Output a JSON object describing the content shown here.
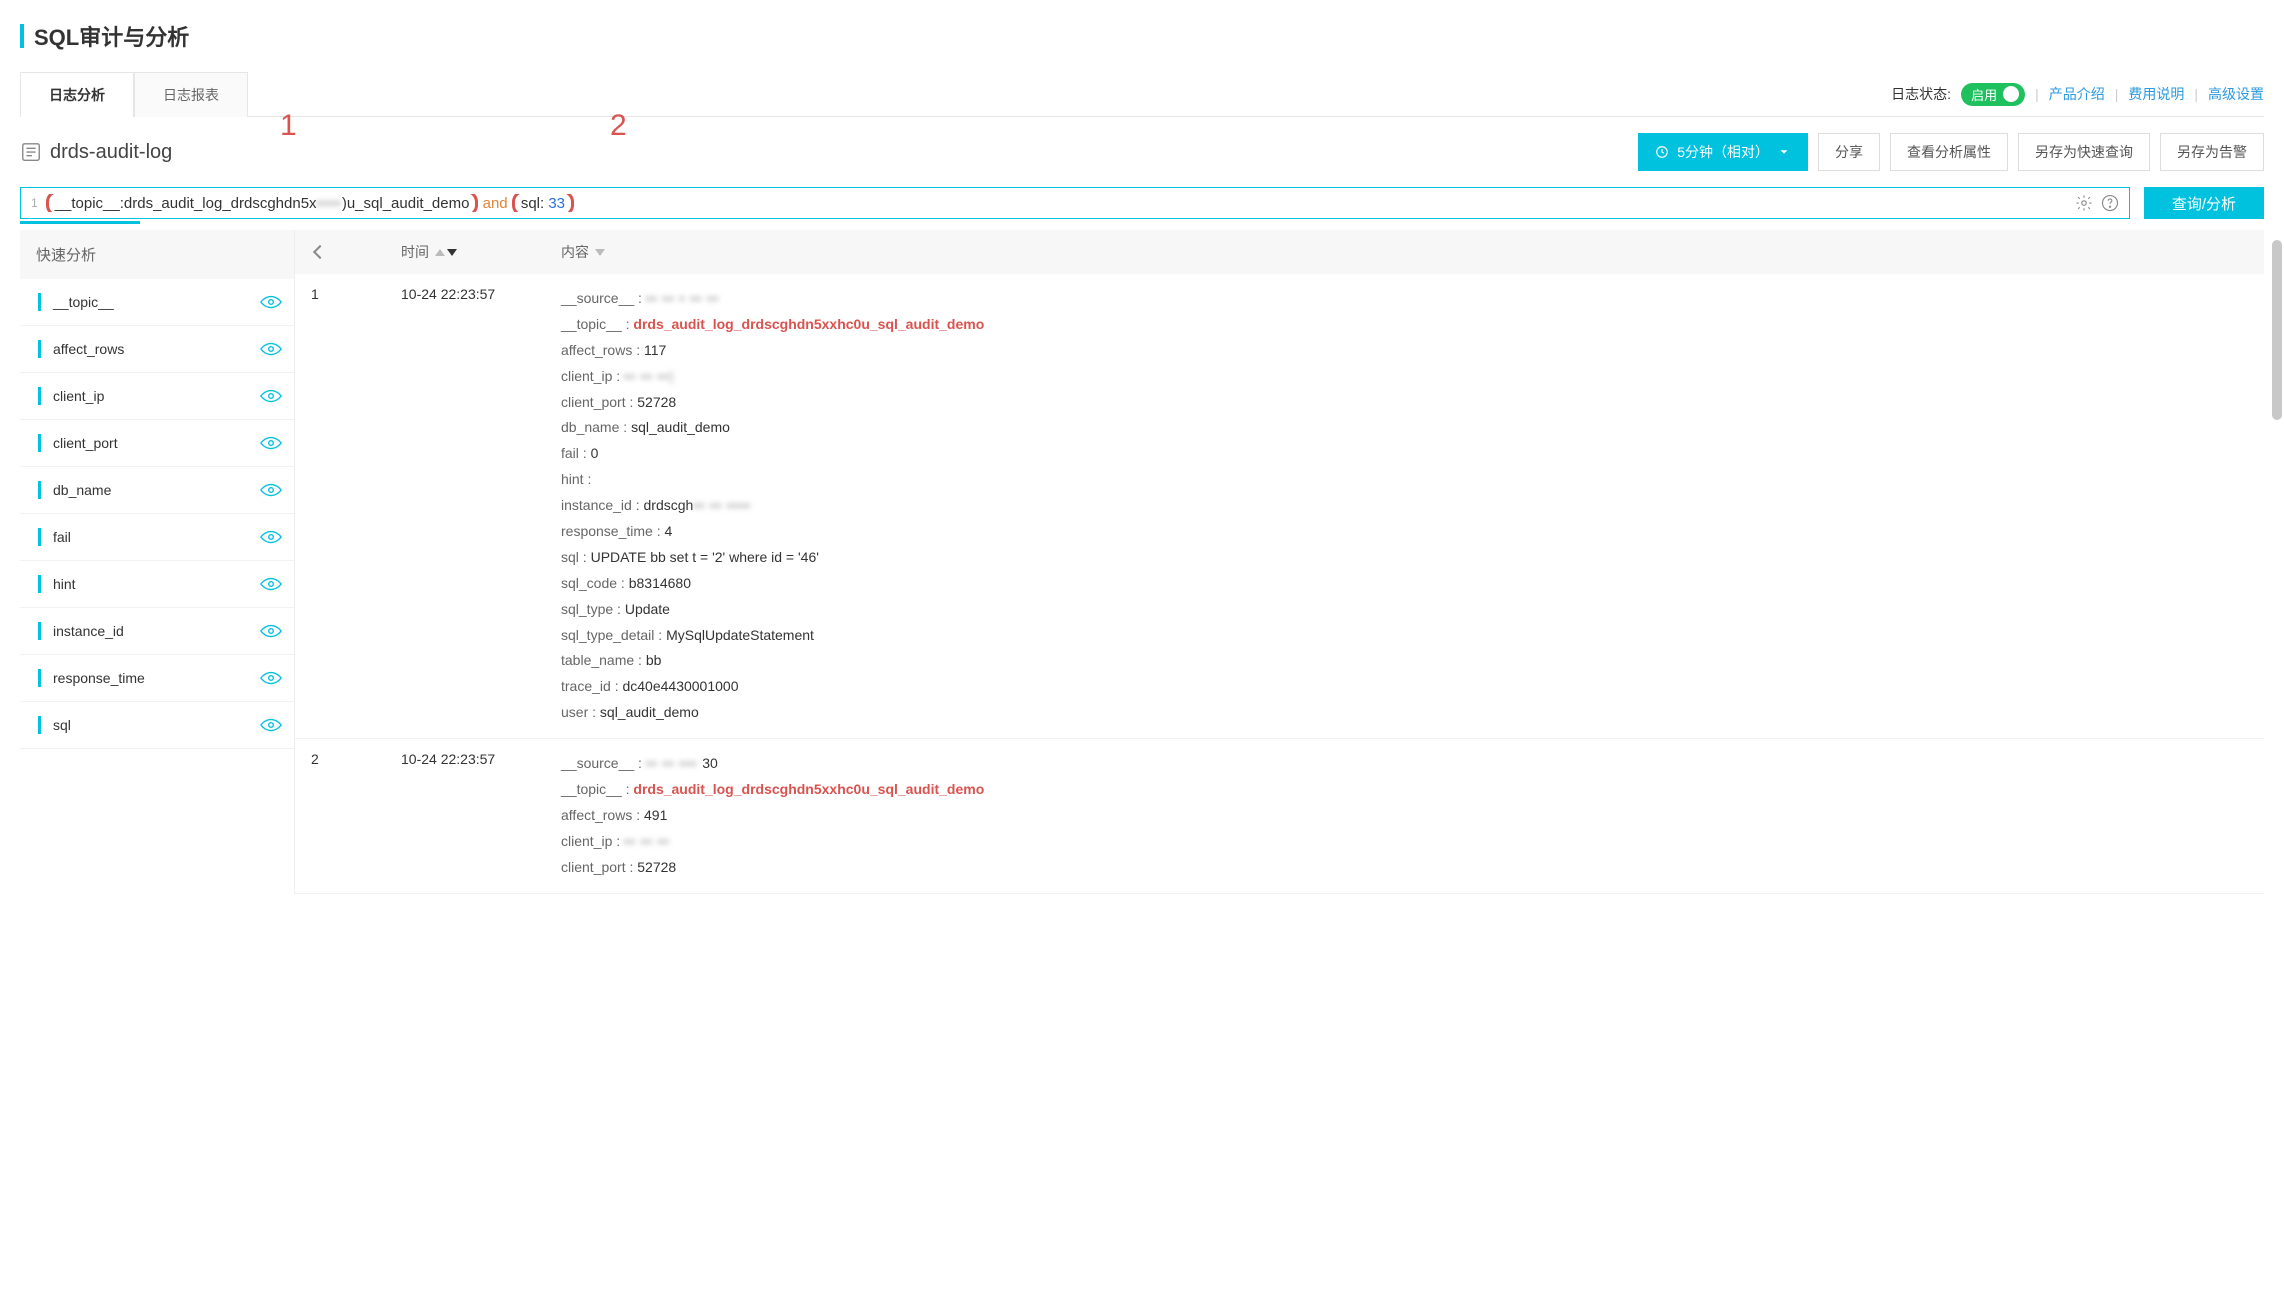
{
  "page_title": "SQL审计与分析",
  "tabs": {
    "analysis": "日志分析",
    "report": "日志报表"
  },
  "header_right": {
    "status_label": "日志状态:",
    "toggle_text": "启用",
    "links": {
      "intro": "产品介绍",
      "billing": "费用说明",
      "advanced": "高级设置"
    }
  },
  "logstore_name": "drds-audit-log",
  "annotations": {
    "one": "1",
    "two": "2"
  },
  "toolbar_buttons": {
    "time": "5分钟（相对）",
    "share": "分享",
    "query_attr": "查看分析属性",
    "save_search": "另存为快速查询",
    "save_alert": "另存为告警"
  },
  "query": {
    "line_no": "1",
    "part1": "__topic__:drds_audit_log_drdscghdn5x",
    "part1_blurred": "▪▪▪▪",
    "part1_tail": ")u_sql_audit_demo",
    "and": " and ",
    "part2_key": "sql: ",
    "part2_val": "33",
    "submit": "查询/分析"
  },
  "sidebar": {
    "title": "快速分析",
    "fields": [
      "__topic__",
      "affect_rows",
      "client_ip",
      "client_port",
      "db_name",
      "fail",
      "hint",
      "instance_id",
      "response_time",
      "sql"
    ]
  },
  "results": {
    "head": {
      "time": "时间",
      "content": "内容"
    },
    "rows": [
      {
        "idx": "1",
        "time": "10-24 22:23:57",
        "kv": [
          {
            "k": "__source__",
            "v": "▪▪ ▪▪ ▪ ▪▪ ▪▪",
            "blur": true
          },
          {
            "k": "__topic__",
            "v": "drds_audit_log_drdscghdn5xxhc0u_sql_audit_demo",
            "red": true
          },
          {
            "k": "affect_rows",
            "v": "117"
          },
          {
            "k": "client_ip",
            "v": "▪▪ ▪▪  ▪▪|",
            "blur": true
          },
          {
            "k": "client_port",
            "v": "52728"
          },
          {
            "k": "db_name",
            "v": "sql_audit_demo"
          },
          {
            "k": "fail",
            "v": "0"
          },
          {
            "k": "hint",
            "v": ""
          },
          {
            "k": "instance_id",
            "v": "drdscgh▪▪ ▪▪ ▪▪▪▪",
            "blurTail": true,
            "visiblePrefix": "drdscgh"
          },
          {
            "k": "response_time",
            "v": "4"
          },
          {
            "k": "sql",
            "v": "UPDATE bb set t = '2' where id = '46'"
          },
          {
            "k": "sql_code",
            "v": "b8314680"
          },
          {
            "k": "sql_type",
            "v": "Update"
          },
          {
            "k": "sql_type_detail",
            "v": "MySqlUpdateStatement"
          },
          {
            "k": "table_name",
            "v": "bb"
          },
          {
            "k": "trace_id",
            "v": "dc40e4430001000"
          },
          {
            "k": "user",
            "v": "sql_audit_demo"
          }
        ]
      },
      {
        "idx": "2",
        "time": "10-24 22:23:57",
        "kv": [
          {
            "k": "__source__",
            "v": "▪▪ ▪▪ ▪▪▪ 30",
            "blur": true,
            "visibleSuffix": "30"
          },
          {
            "k": "__topic__",
            "v": "drds_audit_log_drdscghdn5xxhc0u_sql_audit_demo",
            "red": true
          },
          {
            "k": "affect_rows",
            "v": "491"
          },
          {
            "k": "client_ip",
            "v": "▪▪ ▪▪  ▪▪",
            "blur": true
          },
          {
            "k": "client_port",
            "v": "52728"
          }
        ]
      }
    ]
  }
}
